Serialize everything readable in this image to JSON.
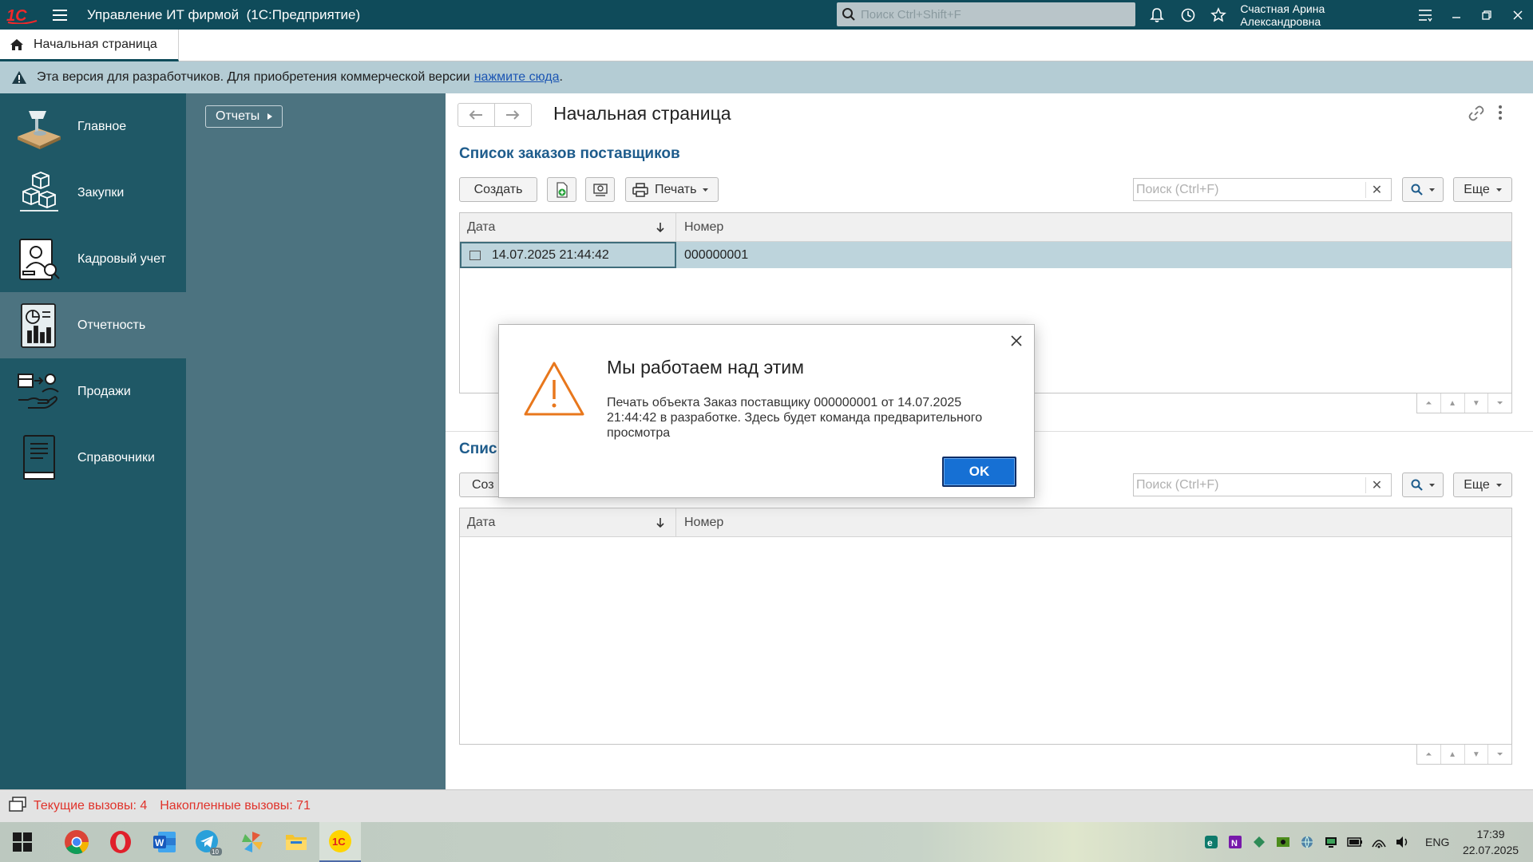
{
  "titlebar": {
    "app_title": "Управление ИТ фирмой  (1С:Предприятие)",
    "search_placeholder": "Поиск Ctrl+Shift+F",
    "user_name": "Счастная Арина Александровна"
  },
  "tabs": {
    "home_label": "Начальная страница"
  },
  "dev_banner": {
    "message": "Эта версия для разработчиков. Для приобретения коммерческой версии",
    "link_text": "нажмите сюда",
    "suffix": "."
  },
  "sections": [
    {
      "label": "Главное",
      "icon": "home-desk-icon",
      "active": false
    },
    {
      "label": "Закупки",
      "icon": "boxes-icon",
      "active": false
    },
    {
      "label": "Кадровый учет",
      "icon": "personnel-icon",
      "active": false
    },
    {
      "label": "Отчетность",
      "icon": "report-chart-icon",
      "active": true
    },
    {
      "label": "Продажи",
      "icon": "sales-hand-icon",
      "active": false
    },
    {
      "label": "Справочники",
      "icon": "book-icon",
      "active": false
    }
  ],
  "function_panel": {
    "reports_button": "Отчеты"
  },
  "main": {
    "page_title": "Начальная страница",
    "list1": {
      "title": "Список заказов поставщиков",
      "create_label": "Создать",
      "print_label": "Печать",
      "search_placeholder": "Поиск (Ctrl+F)",
      "more_label": "Еще",
      "columns": [
        "Дата",
        "Номер"
      ],
      "rows": [
        {
          "date": "14.07.2025 21:44:42",
          "number": "000000001",
          "selected": true
        }
      ]
    },
    "list2": {
      "title": "Спис",
      "create_label": "Соз",
      "search_placeholder": "Поиск (Ctrl+F)",
      "more_label": "Еще",
      "columns": [
        "Дата",
        "Номер"
      ],
      "rows": []
    }
  },
  "dialog": {
    "title": "Мы работаем над этим",
    "message": "Печать объекта Заказ поставщику 000000001 от 14.07.2025 21:44:42 в разработке. Здесь будет команда предварительного просмотра",
    "ok_label": "OK"
  },
  "statusbar": {
    "current_calls": "Текущие вызовы: 4",
    "accumulated_calls": "Накопленные вызовы: 71"
  },
  "taskbar": {
    "apps": [
      "windows-start-icon",
      "chrome-icon",
      "opera-icon",
      "word-icon",
      "telegram-icon",
      "pinwheel-app-icon",
      "file-explorer-icon",
      "1c-icon"
    ],
    "telegram_badge": "10",
    "language": "ENG",
    "time": "17:39",
    "date": "22.07.2025"
  },
  "colors": {
    "titlebar_bg": "#0f4b5a",
    "sections_bg": "#1f5866",
    "panel_bg": "#4c7380",
    "list_title": "#1e5c8c",
    "ok_button": "#1670d4",
    "status_text": "#e0332b",
    "warning_icon": "#e8771c"
  }
}
